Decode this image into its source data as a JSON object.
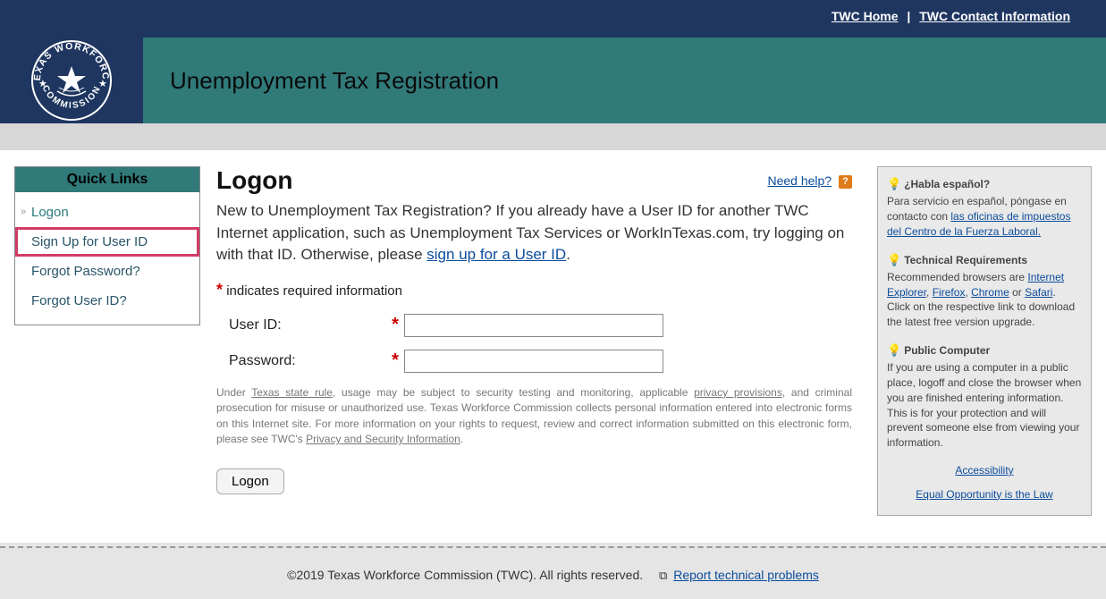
{
  "topbar": {
    "home": "TWC Home",
    "contact": "TWC Contact Information"
  },
  "header": {
    "title": "Unemployment Tax Registration",
    "logo_alt": "Texas Workforce Commission"
  },
  "sidebar": {
    "heading": "Quick Links",
    "items": [
      {
        "label": "Logon"
      },
      {
        "label": "Sign Up for User ID"
      },
      {
        "label": "Forgot Password?"
      },
      {
        "label": "Forgot User ID?"
      }
    ]
  },
  "main": {
    "heading": "Logon",
    "need_help": "Need help?",
    "intro_a": "New to Unemployment Tax Registration? If you already have a User ID for another TWC Internet application, such as Unemployment Tax Services or WorkInTexas.com, try logging on with that ID. Otherwise, please ",
    "intro_link": "sign up for a User ID",
    "intro_b": ".",
    "required_note": "indicates required information",
    "user_id_label": "User ID:",
    "password_label": "Password:",
    "user_id_value": "",
    "password_value": "",
    "legal_a": "Under ",
    "legal_link1": "Texas state rule",
    "legal_b": ", usage may be subject to security testing and monitoring, applicable ",
    "legal_link2": "privacy provisions",
    "legal_c": ", and criminal prosecution for misuse or unauthorized use. Texas Workforce Commission collects personal information entered into electronic forms on this Internet site. For more information on your rights to request, review and correct information submitted on this electronic form, please see TWC's ",
    "legal_link3": "Privacy and Security Information",
    "legal_d": ".",
    "logon_button": "Logon"
  },
  "right": {
    "esp_title": "¿Habla español?",
    "esp_text": "Para servicio en español, póngase en contacto con ",
    "esp_link": "las oficinas de impuestos del Centro de la Fuerza Laboral.",
    "tech_title": "Technical Requirements",
    "tech_a": "Recommended browsers are ",
    "tech_link1": "Internet Explorer",
    "tech_sep1": ", ",
    "tech_link2": "Firefox",
    "tech_sep2": ", ",
    "tech_link3": "Chrome",
    "tech_sep3": " or ",
    "tech_link4": "Safari",
    "tech_b": ". Click on the respective link to download the latest free version upgrade.",
    "pub_title": "Public Computer",
    "pub_text": "If you are using a computer in a public place, logoff and close the browser when you are finished entering information. This is for your protection and will prevent someone else from viewing your information.",
    "accessibility": "Accessibility",
    "eeo": "Equal Opportunity is the Law"
  },
  "footer": {
    "copyright": "©2019  Texas Workforce Commission (TWC). All rights reserved.",
    "report": "Report technical problems"
  }
}
